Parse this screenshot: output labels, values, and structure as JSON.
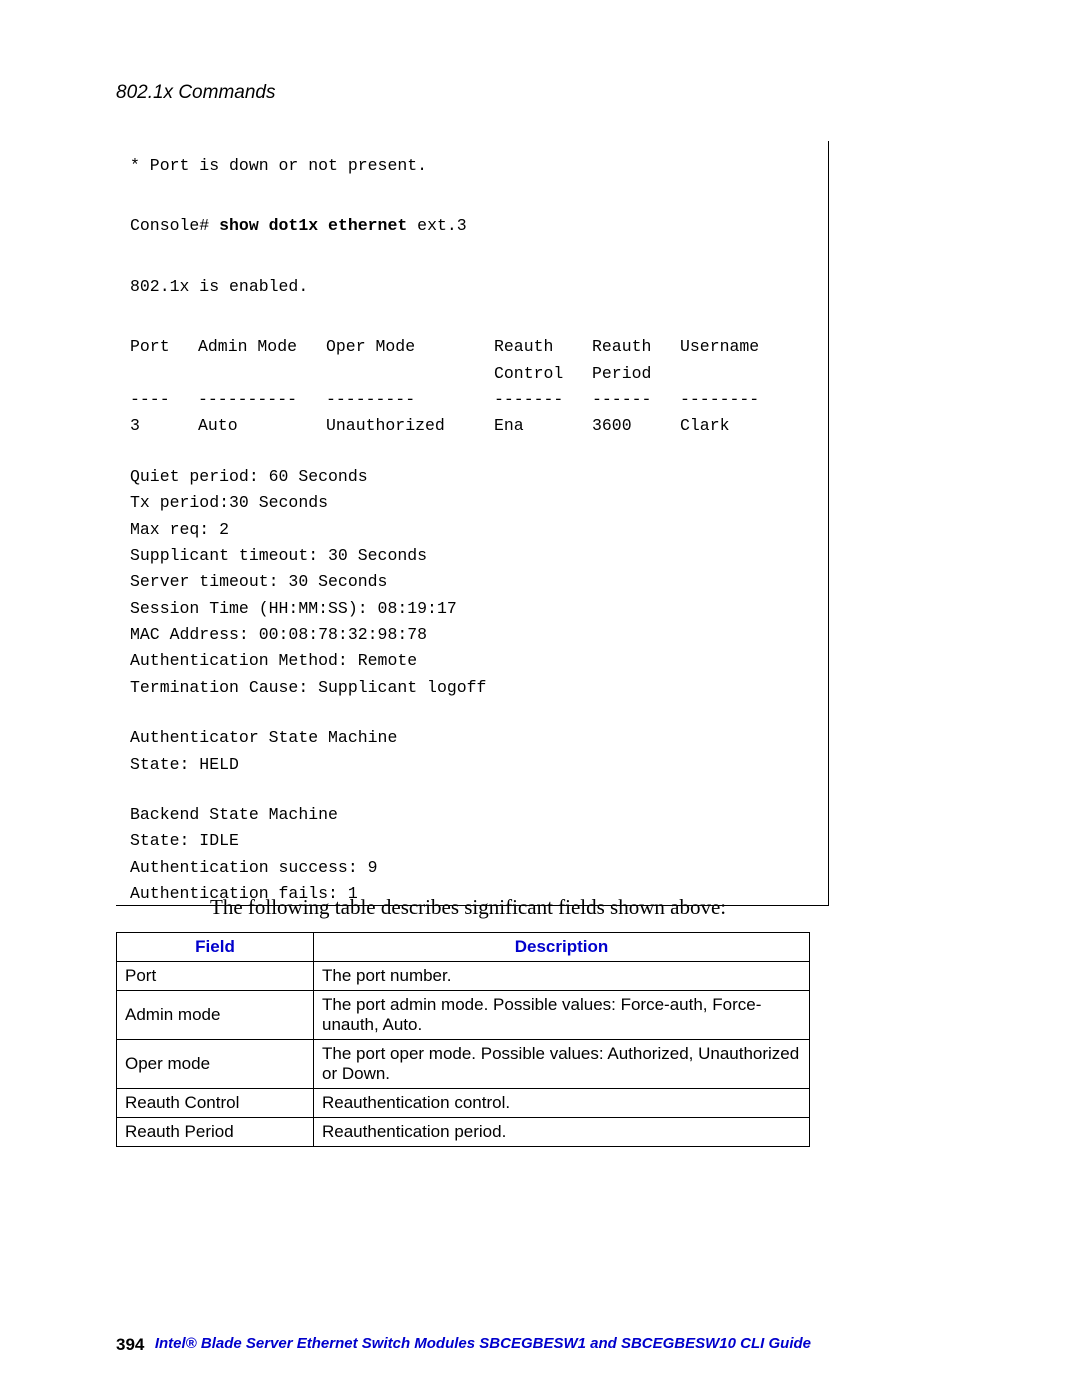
{
  "header": {
    "section_title": "802.1x Commands"
  },
  "console": {
    "note": "* Port is down or not present.",
    "prompt": "Console# ",
    "cmd_bold": "show dot1x ethernet ",
    "cmd_arg": "ext.3",
    "enabled": "802.1x is enabled.",
    "hdr": {
      "c1": "Port",
      "c2": "Admin Mode",
      "c3": "Oper Mode",
      "c4a": "Reauth",
      "c4b": "Control",
      "c5a": "Reauth",
      "c5b": "Period",
      "c6": "Username"
    },
    "sep": {
      "c1": "----",
      "c2": "----------",
      "c3": "---------",
      "c4": "-------",
      "c5": "------",
      "c6": "--------"
    },
    "row": {
      "c1": "3",
      "c2": "Auto",
      "c3": "Unauthorized",
      "c4": "Ena",
      "c5": "3600",
      "c6": "Clark"
    },
    "details": {
      "quiet": "Quiet period: 60 Seconds",
      "tx": "Tx period:30 Seconds",
      "maxreq": "Max req: 2",
      "supp": "Supplicant timeout: 30 Seconds",
      "srv": "Server timeout: 30 Seconds",
      "sess": "Session Time (HH:MM:SS): 08:19:17",
      "mac": "MAC Address: 00:08:78:32:98:78",
      "authmeth": "Authentication Method: Remote",
      "term": "Termination Cause: Supplicant logoff"
    },
    "asm": {
      "title": "Authenticator State Machine",
      "state": "State: HELD"
    },
    "bsm": {
      "title": "Backend State Machine",
      "state": "State: IDLE",
      "succ": "Authentication success: 9",
      "fail": "Authentication fails: 1"
    }
  },
  "caption": "The following table describes significant fields shown above:",
  "table": {
    "hdr_field": "Field",
    "hdr_desc": "Description",
    "rows": [
      {
        "f": "Port",
        "d": "The port number."
      },
      {
        "f": "Admin mode",
        "d": "The port admin mode. Possible values: Force-auth, Force-unauth, Auto."
      },
      {
        "f": "Oper mode",
        "d": "The port oper mode. Possible values: Authorized, Unauthorized or Down."
      },
      {
        "f": "Reauth Control",
        "d": "Reauthentication control."
      },
      {
        "f": "Reauth Period",
        "d": "Reauthentication period."
      }
    ]
  },
  "footer": {
    "page": "394",
    "title": "Intel® Blade Server Ethernet Switch Modules SBCEGBESW1 and SBCEGBESW10 CLI Guide"
  }
}
